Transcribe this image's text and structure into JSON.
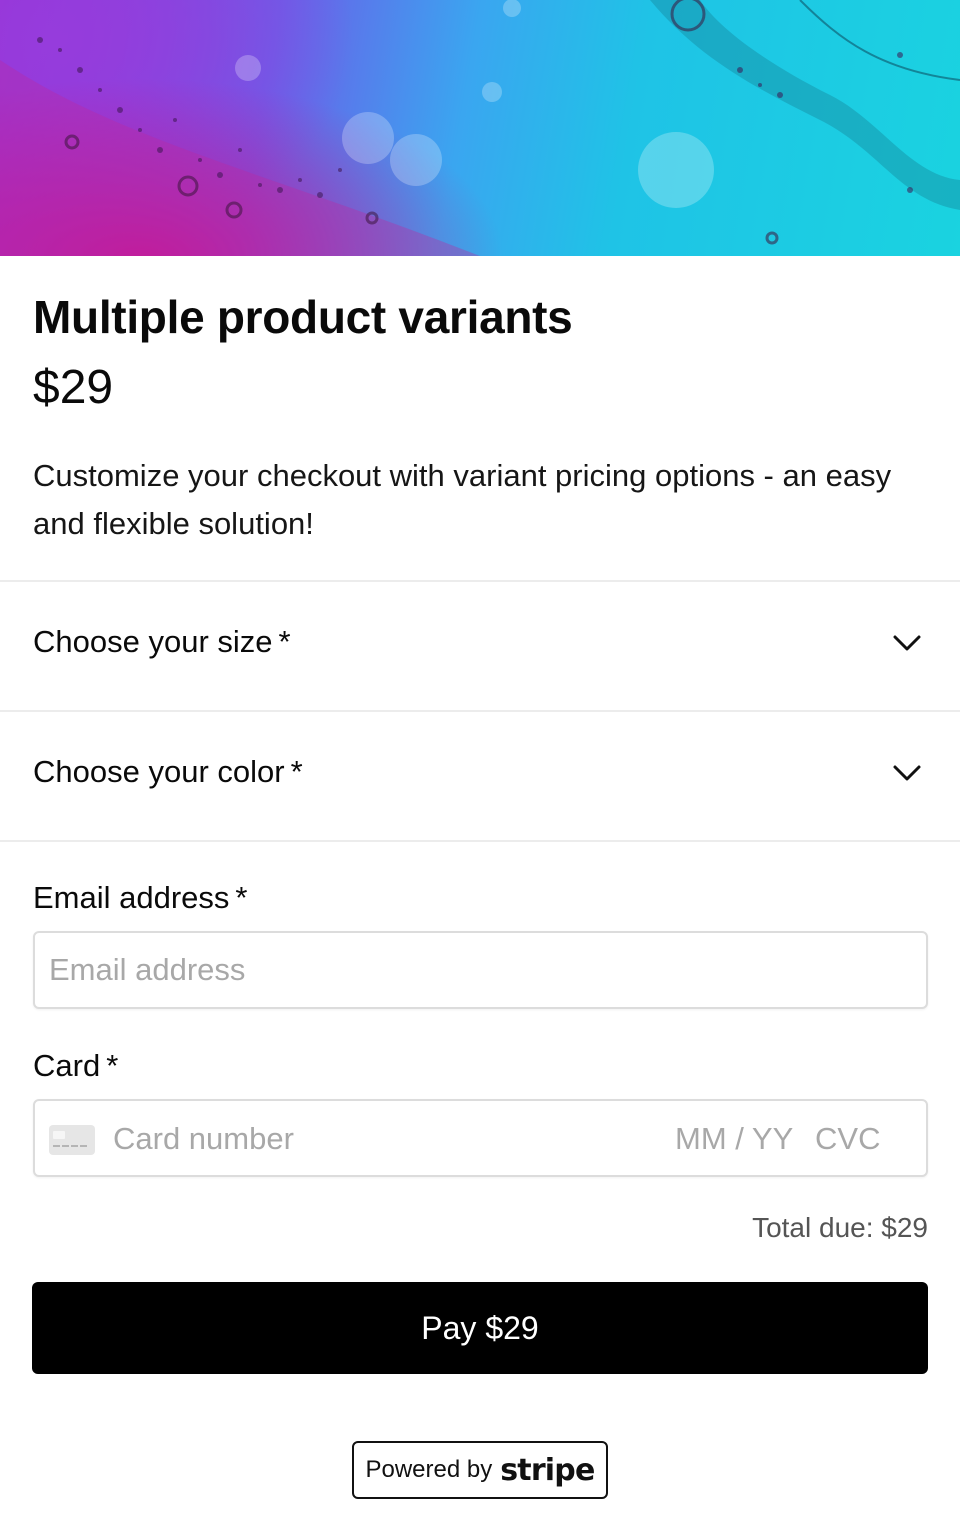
{
  "product": {
    "title": "Multiple product variants",
    "price": "$29",
    "description": "Customize your checkout with variant pricing options - an easy and flexible solution!"
  },
  "options": [
    {
      "label": "Choose your size",
      "required_mark": "*",
      "icon": "chevron-down-icon"
    },
    {
      "label": "Choose your color",
      "required_mark": "*",
      "icon": "chevron-down-icon"
    }
  ],
  "email": {
    "label": "Email address",
    "required_mark": "*",
    "placeholder": "Email address",
    "value": ""
  },
  "card": {
    "label": "Card",
    "required_mark": "*",
    "number_placeholder": "Card number",
    "expiry_placeholder": "MM / YY",
    "cvc_placeholder": "CVC",
    "icon": "credit-card-icon"
  },
  "summary": {
    "total_due": "Total due: $29"
  },
  "pay_button": {
    "label": "Pay $29"
  },
  "footer": {
    "powered_by": "Powered by",
    "brand": "stripe"
  },
  "colors": {
    "button_bg": "#000000",
    "hero_cyan": "#1fc3e6",
    "hero_magenta": "#c81496",
    "hero_violet": "#9b2fd6"
  }
}
